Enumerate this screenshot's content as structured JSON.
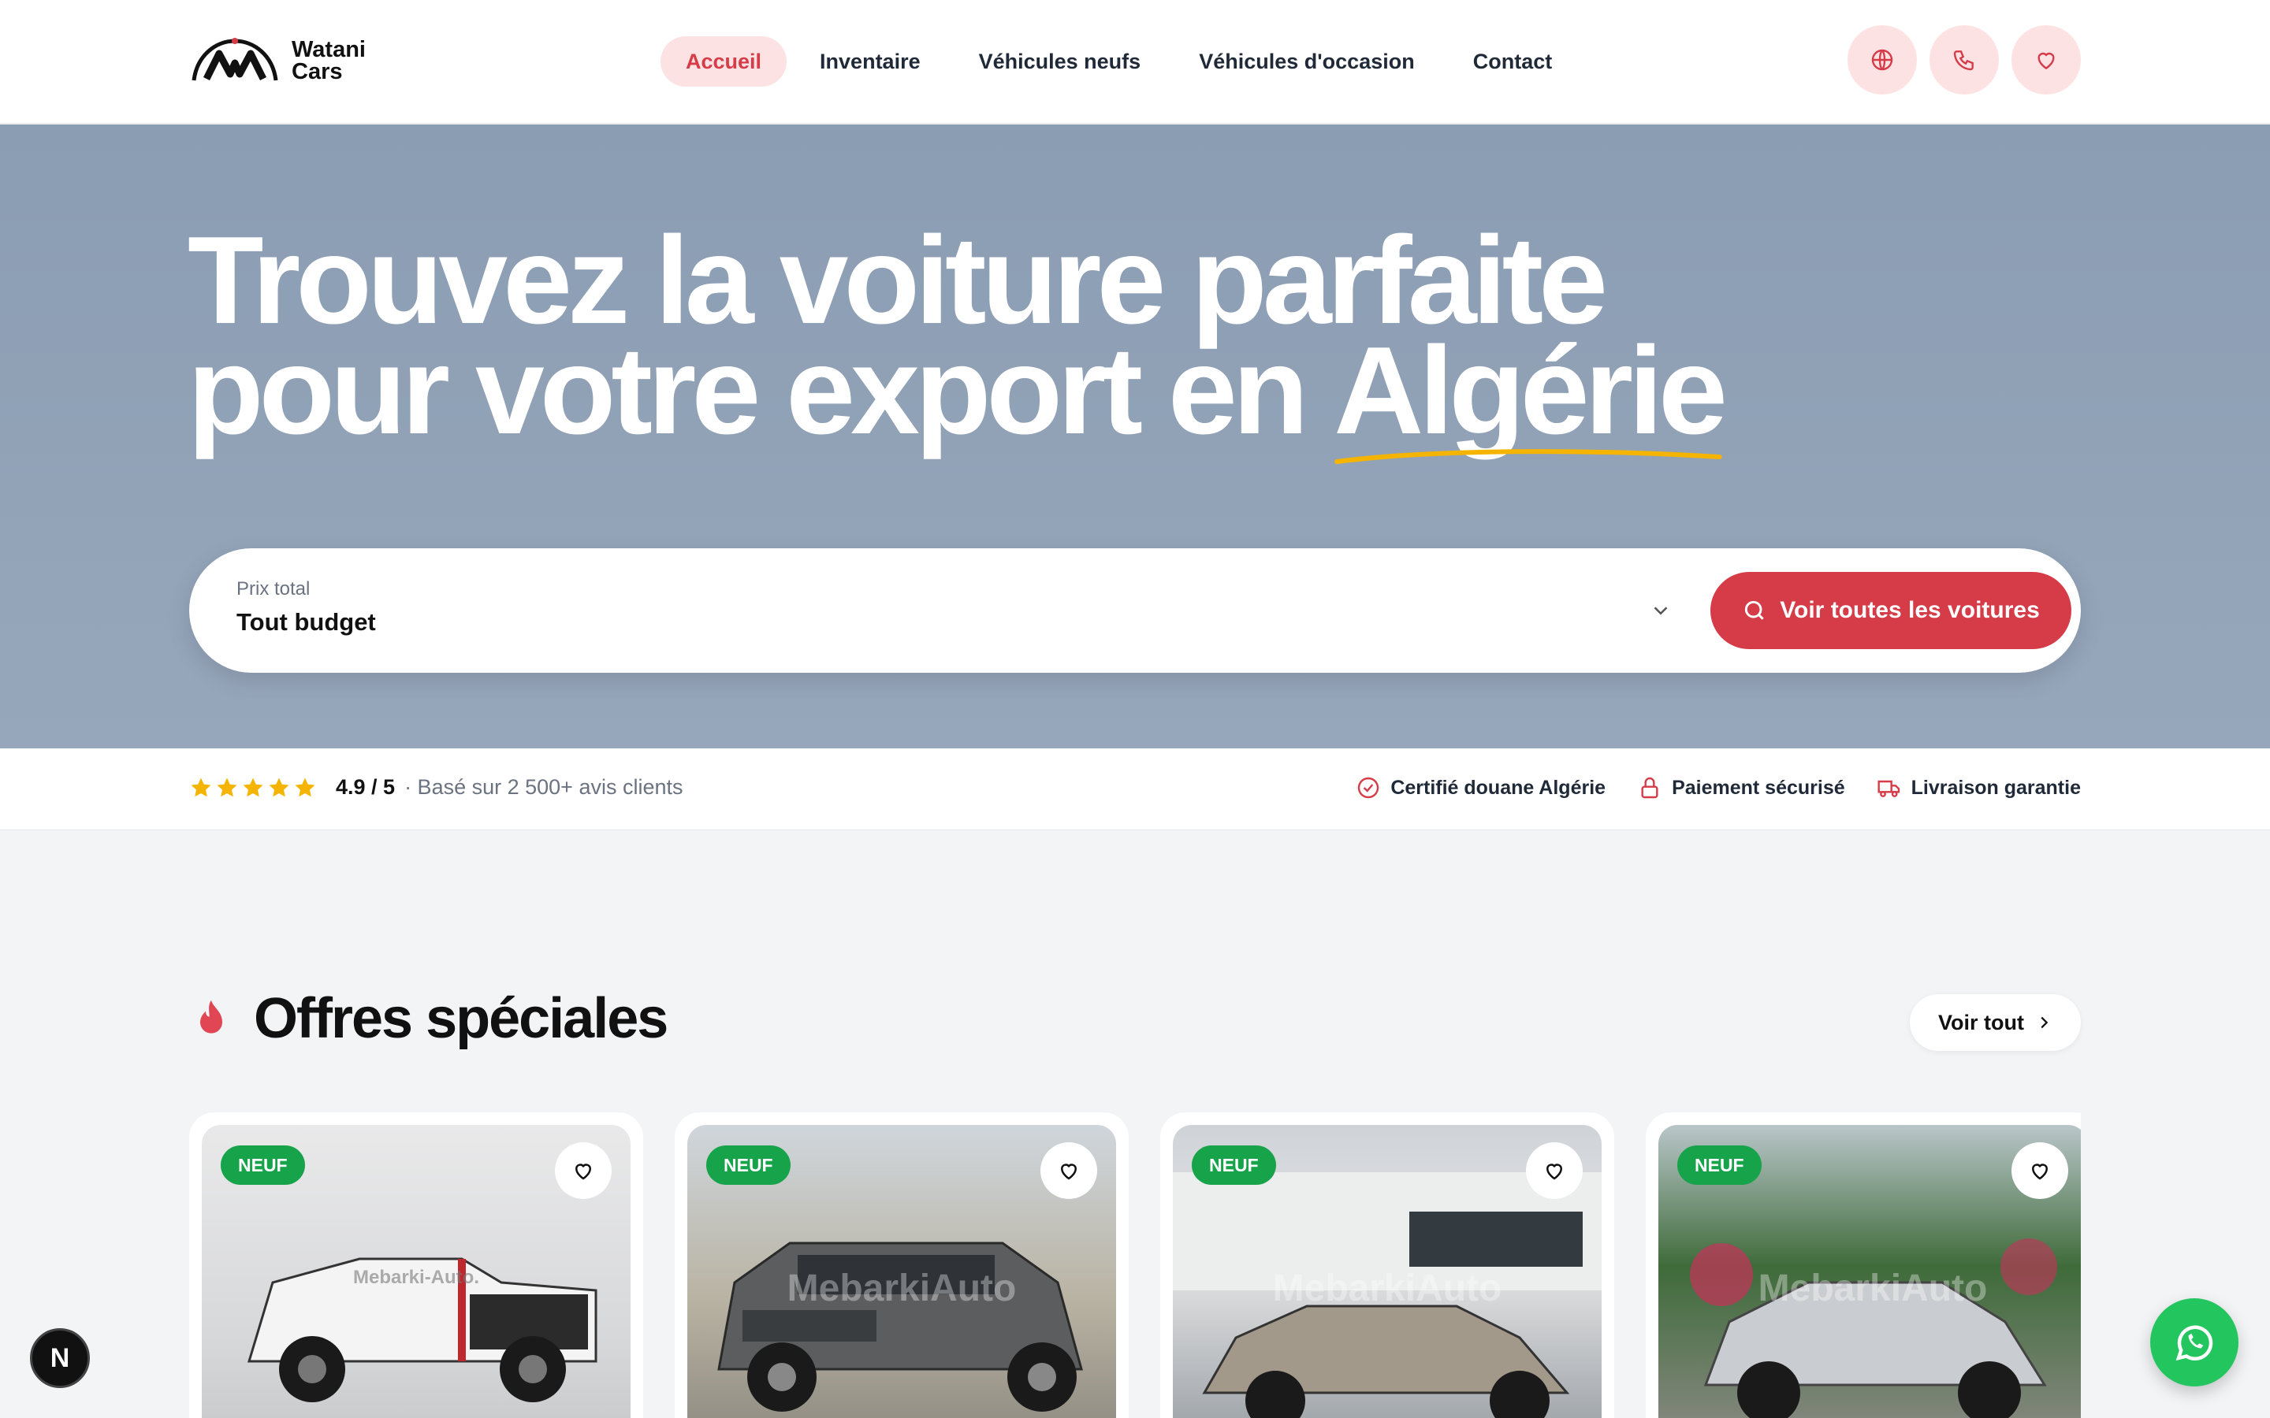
{
  "brand": {
    "name_line1": "Watani",
    "name_line2": "Cars"
  },
  "nav": {
    "items": [
      {
        "label": "Accueil",
        "active": true
      },
      {
        "label": "Inventaire"
      },
      {
        "label": "Véhicules neufs"
      },
      {
        "label": "Véhicules d'occasion"
      },
      {
        "label": "Contact"
      }
    ]
  },
  "header_icons": [
    "globe-icon",
    "phone-icon",
    "heart-icon"
  ],
  "hero": {
    "title_line1": "Trouvez la voiture parfaite",
    "title_line2_prefix": "pour votre export en ",
    "title_highlight": "Algérie"
  },
  "search": {
    "label": "Prix total",
    "value": "Tout budget",
    "button_label": "Voir toutes les voitures"
  },
  "trust": {
    "rating_stars": 5,
    "score": "4.9 / 5",
    "subtitle": "· Basé sur 2 500+ avis clients",
    "badges": [
      {
        "label": "Certifié douane Algérie",
        "icon": "check-circle-icon"
      },
      {
        "label": "Paiement sécurisé",
        "icon": "lock-icon"
      },
      {
        "label": "Livraison garantie",
        "icon": "truck-icon"
      }
    ]
  },
  "section": {
    "title": "Offres spéciales",
    "see_all": "Voir tout"
  },
  "cards": [
    {
      "tag": "NEUF",
      "watermark": "Mebarki-Auto."
    },
    {
      "tag": "NEUF",
      "watermark": "MebarkiAuto"
    },
    {
      "tag": "NEUF",
      "watermark": "MebarkiAuto"
    },
    {
      "tag": "NEUF",
      "watermark": "MebarkiAuto"
    }
  ],
  "floating": {
    "next_badge": "N"
  },
  "colors": {
    "accent": "#d63b48",
    "accent_soft": "#fde2e4",
    "hero_bg": "#8b9db3",
    "new_tag": "#17a34a",
    "whatsapp": "#22c55e",
    "star": "#f5b400"
  }
}
